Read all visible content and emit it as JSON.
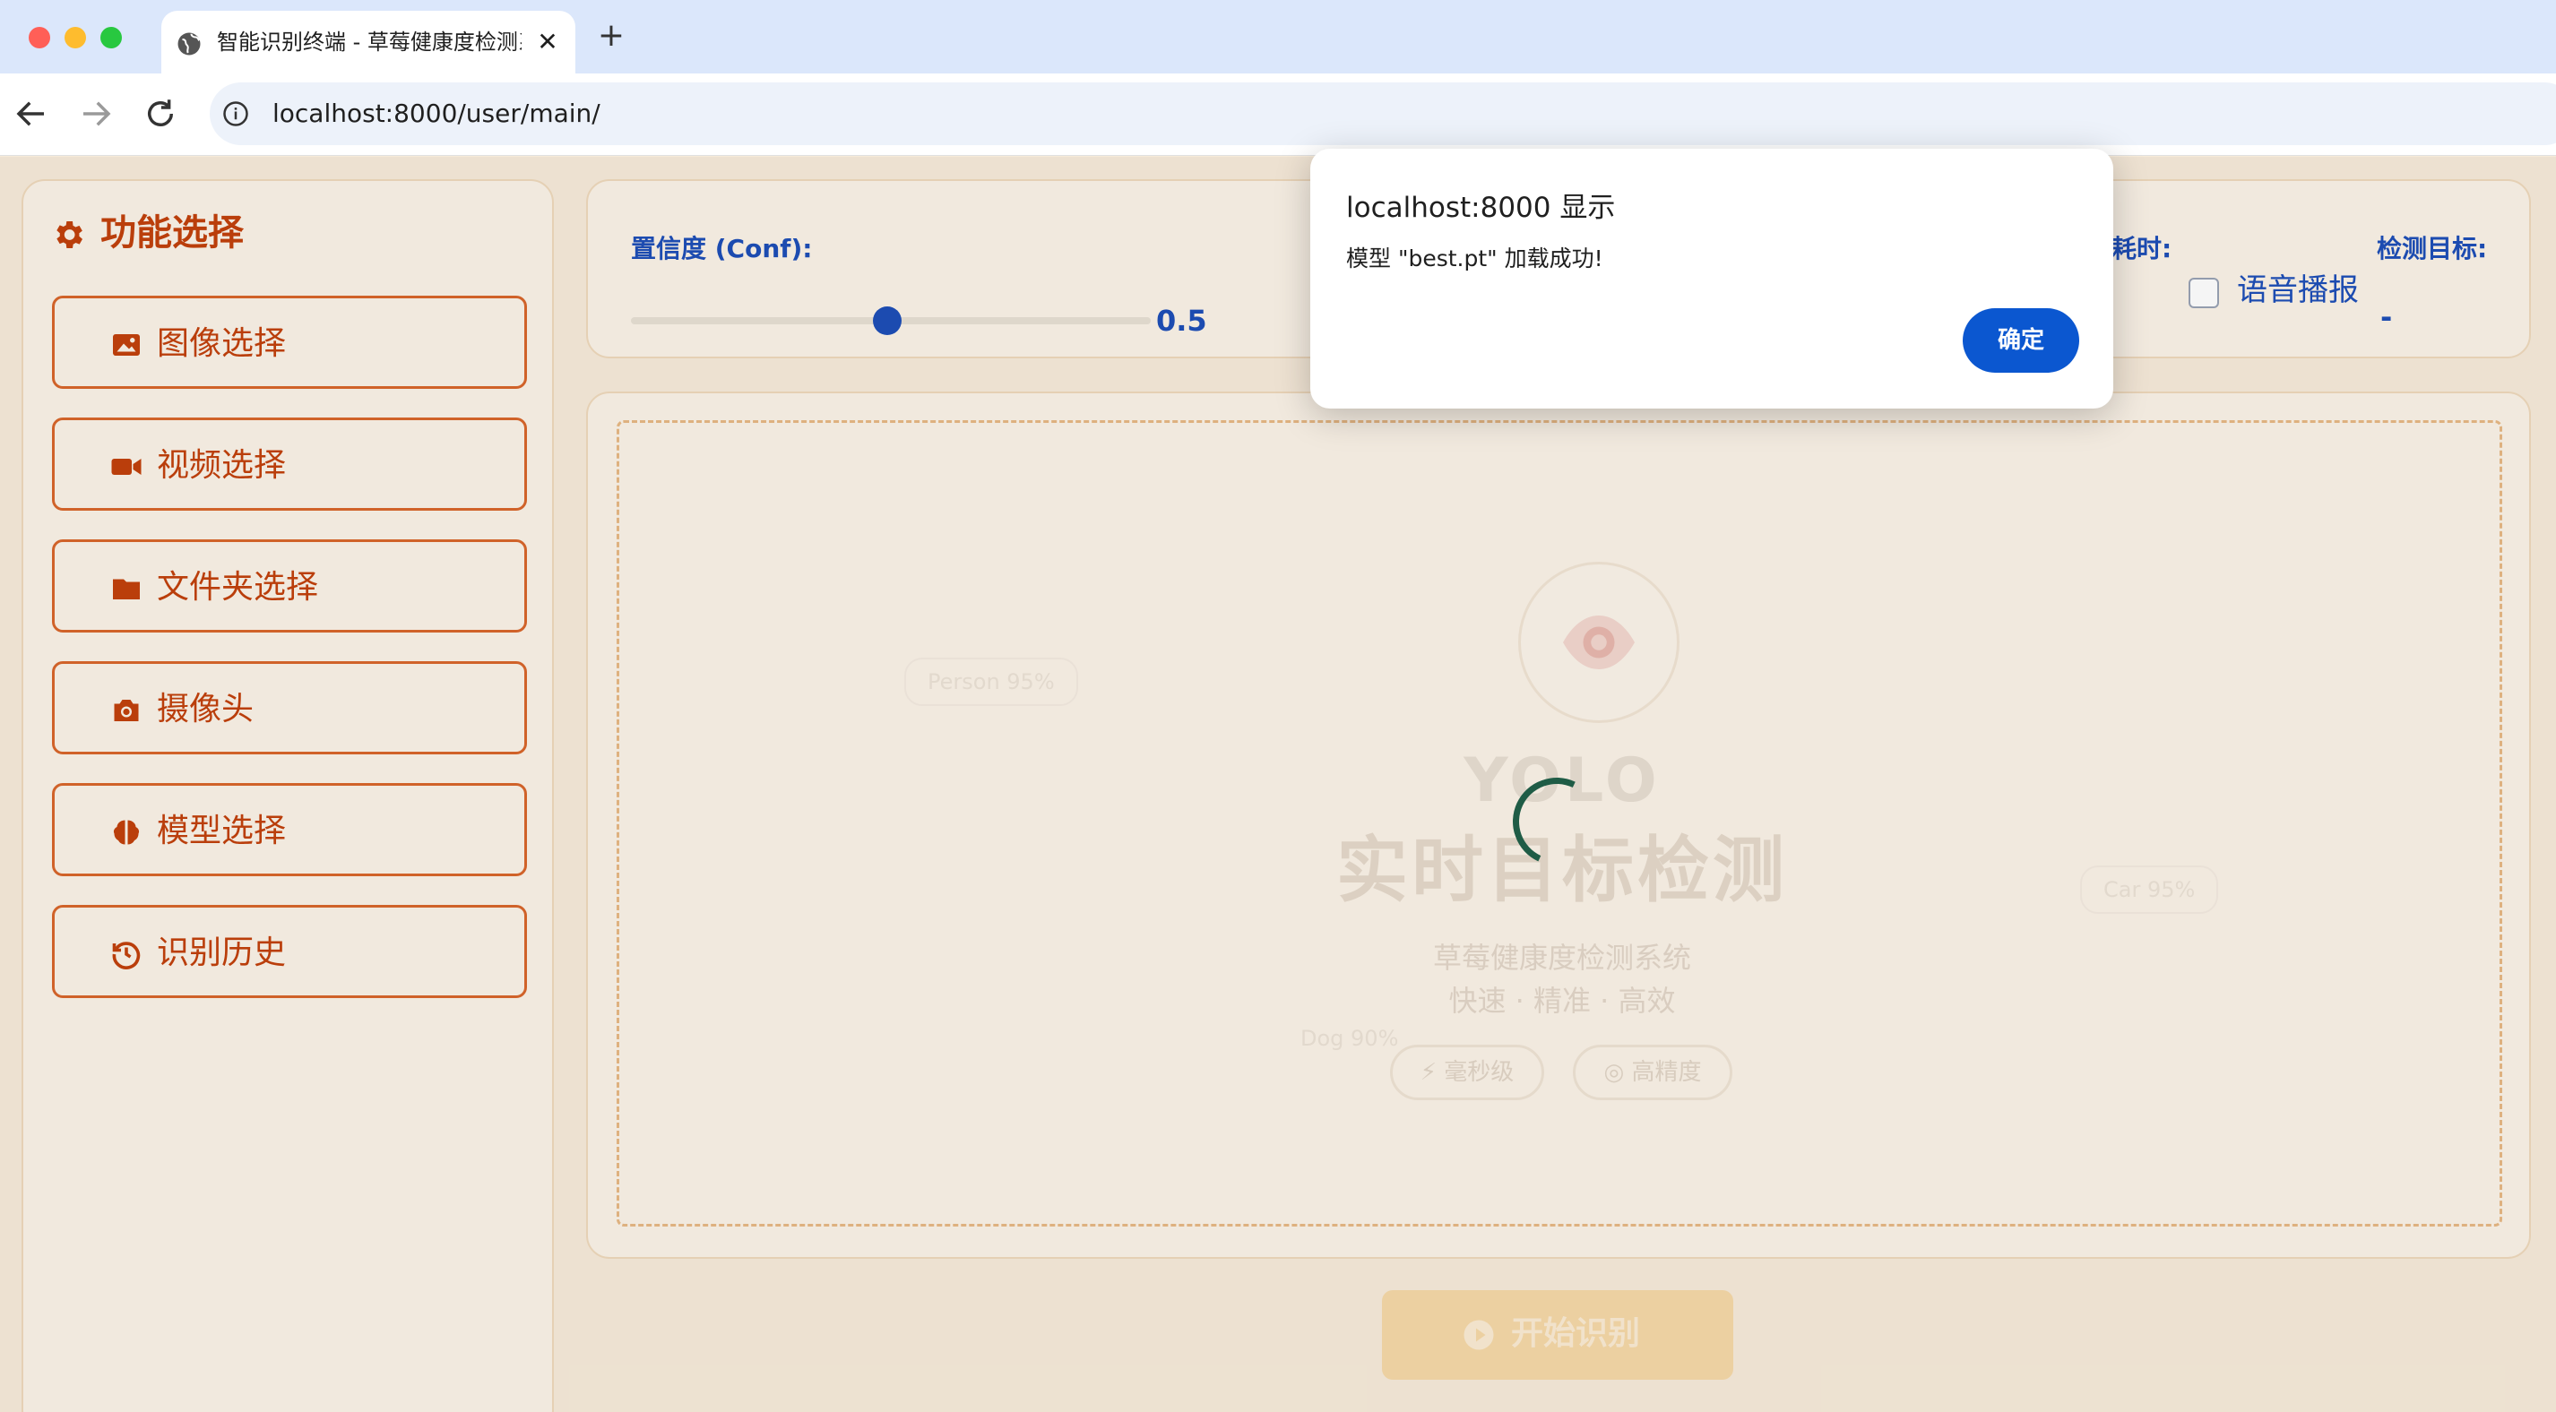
{
  "browser": {
    "tab_title": "智能识别终端 - 草莓健康度检测系统",
    "close_label": "✕",
    "new_tab_label": "+",
    "url": "localhost:8000/user/main/"
  },
  "sidebar": {
    "title": "功能选择",
    "items": [
      {
        "label": "图像选择",
        "icon": "image-icon"
      },
      {
        "label": "视频选择",
        "icon": "video-camera-icon"
      },
      {
        "label": "文件夹选择",
        "icon": "folder-icon"
      },
      {
        "label": "摄像头",
        "icon": "camera-icon"
      },
      {
        "label": "模型选择",
        "icon": "brain-icon"
      },
      {
        "label": "识别历史",
        "icon": "history-icon"
      }
    ]
  },
  "controls": {
    "conf_label": "置信度 (Conf):",
    "conf_value": "0.5",
    "conf_fraction": 0.5,
    "time_label": "耗时:",
    "voice_label": "语音播报",
    "voice_checked": false,
    "target_label": "检测目标:",
    "target_value": "-"
  },
  "placeholder": {
    "yolo": "YOLO",
    "headline": "实时目标检测",
    "subtitle": "草莓健康度检测系统",
    "tagline": "快速 · 精准 · 高效",
    "badge_1": "⚡ 毫秒级",
    "badge_2": "◎ 高精度",
    "ghost_1": "Person 95%",
    "ghost_2": "Car 95%",
    "ghost_3": "Dog 90%"
  },
  "start_button": {
    "label": "开始识别"
  },
  "dialog": {
    "title": "localhost:8000 显示",
    "message": "模型 \"best.pt\" 加载成功!",
    "ok_label": "确定"
  },
  "colors": {
    "accent": "#c2410c",
    "primary": "#1e4fb8",
    "dialog_button": "#0b57d0"
  }
}
